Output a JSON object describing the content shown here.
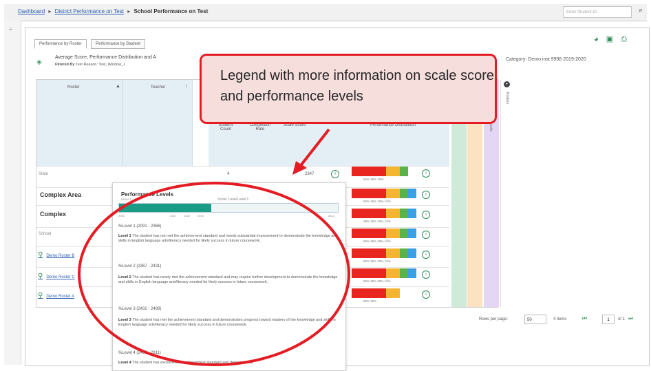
{
  "breadcrumb": {
    "items": [
      "Dashboard",
      "District Performance on Test",
      "School Performance on Test"
    ]
  },
  "search": {
    "placeholder": "Enter Student ID"
  },
  "icons": {
    "search": "search-icon",
    "chart": "chart-icon",
    "print": "printer-icon",
    "print2": "print-icon"
  },
  "tabs": [
    "Performance by Roster",
    "Performance by Student"
  ],
  "report": {
    "title": "Average Score, Performance Distribution and A",
    "filter_label": "Filtered By",
    "filter_text": "Test Reason: Test_Window_1",
    "right_text": "Category: Demo inst 9998 2019-2020"
  },
  "grid": {
    "col_roster": "Roster",
    "col_teacher": "Teacher",
    "col_student_count": "Student Count",
    "col_completion": "Completion Rate",
    "col_scale_score": "Scale Score",
    "col_perf_dist": "Performance Distribution",
    "col_vertical_1": "Lexile",
    "col_vertical_2": "Rosters",
    "rows": [
      {
        "label": "State",
        "count": "4",
        "score": "2347",
        "pcts": "50%  25%  25%"
      },
      {
        "label": "Complex Area",
        "count": "",
        "score": "",
        "pcts": "50%  25%  25%  12%"
      },
      {
        "label": "Complex",
        "count": "",
        "score": "",
        "pcts": "38%  25%  25%  12%"
      },
      {
        "label": "School",
        "count": "",
        "score": "",
        "pcts": "50%  25%  25%  12%"
      },
      {
        "label": "Demo Roster B",
        "count": "",
        "score": "",
        "pcts": "50%  25%  25%  12%"
      },
      {
        "label": "Demo Roster C",
        "count": "",
        "score": "",
        "pcts": "50%  25%  25%  12%"
      },
      {
        "label": "Demo Roster A",
        "count": "",
        "score": "",
        "pcts": "50%  25%"
      }
    ]
  },
  "popover": {
    "title": "Performance Levels",
    "subtitle": "Level 1",
    "scale_label": "Score: Level Level 1",
    "level_score_fraction": 0.42,
    "levels": [
      {
        "heading": "%Level 1 (2091 - 2366)",
        "name": "Level 1",
        "text": "The student has not met the achievement standard and needs substantial improvement to demonstrate the knowledge and skills in English language arts/literacy needed for likely success in future coursework."
      },
      {
        "heading": "%Level 2 (2367 - 2431)",
        "name": "Level 2",
        "text": "The student has nearly met the achievement standard and may require further development to demonstrate the knowledge and skills in English language arts/literacy needed for likely success in future coursework."
      },
      {
        "heading": "%Level 3 (2432 - 2489)",
        "name": "Level 3",
        "text": "The student has met the achievement standard and demonstrates progress toward mastery of the knowledge and skills in English language arts/literacy needed for likely success in future coursework."
      },
      {
        "heading": "%Level 4 (2490 - 2811)",
        "name": "Level 4",
        "text": "The student has exceeded the achievement standard and demonstrates"
      }
    ]
  },
  "pagination": {
    "rows_per_page_label": "Rows per page:",
    "rows_per_page": "50",
    "items": "4 items",
    "page": "1",
    "of": "of 1"
  },
  "callout": {
    "text": "Legend with more information on scale score and performance levels"
  },
  "colors": {
    "level1": "#e8261f",
    "level2": "#f5b52f",
    "level3": "#5ab34a",
    "level4": "#3aa0e6",
    "callout_border": "#e41c23",
    "callout_fill": "#f6dedd",
    "ellipse": "#e41c23"
  }
}
